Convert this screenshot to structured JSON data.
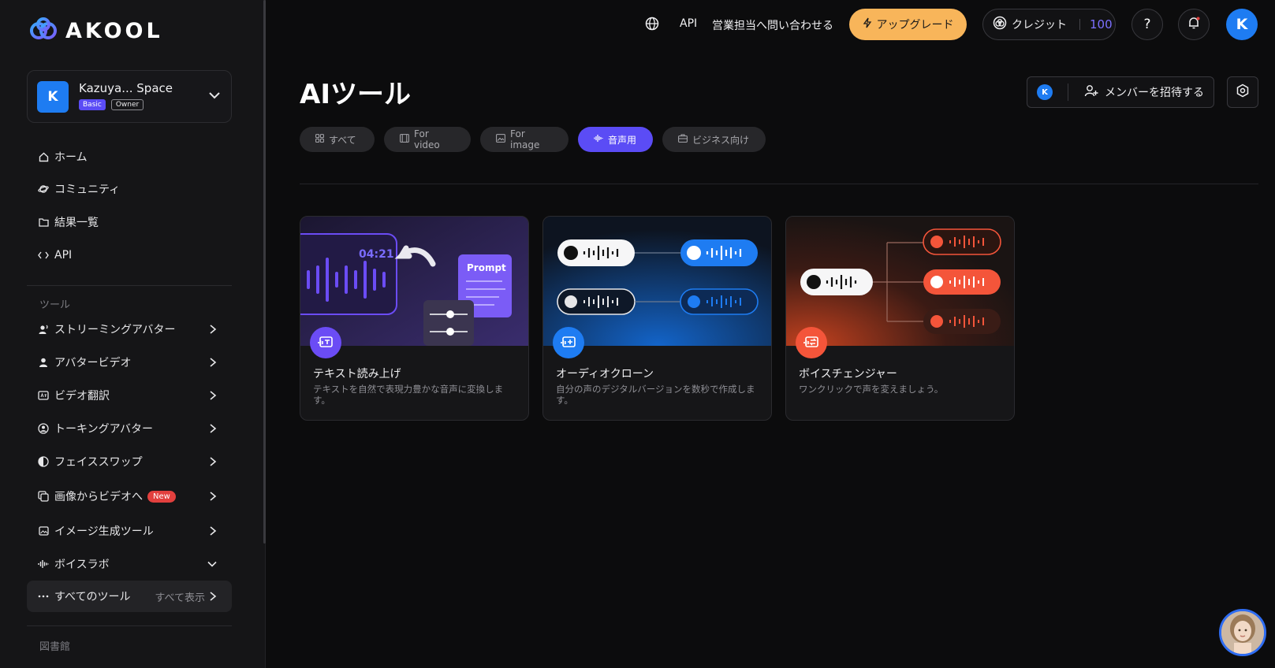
{
  "app": {
    "logo_text": "AKOOL"
  },
  "workspace": {
    "avatar_letter": "K",
    "name": "Kazuya... Space",
    "plan_badge": "Basic",
    "role_badge": "Owner"
  },
  "nav": {
    "home": "ホーム",
    "community": "コミュニティ",
    "results": "結果一覧",
    "api": "API"
  },
  "tools": {
    "section_label": "ツール",
    "items": [
      {
        "label": "ストリーミングアバター"
      },
      {
        "label": "アバタービデオ"
      },
      {
        "label": "ビデオ翻訳"
      },
      {
        "label": "トーキングアバター"
      },
      {
        "label": "フェイススワップ"
      },
      {
        "label": "画像からビデオへ",
        "badge": "New"
      },
      {
        "label": "イメージ生成ツール"
      },
      {
        "label": "ボイスラボ"
      }
    ],
    "all_tools_label": "すべてのツール",
    "see_all_label": "すべて表示"
  },
  "library": {
    "section_label": "図書館"
  },
  "header": {
    "api_label": "API",
    "contact_label": "営業担当へ問い合わせる",
    "upgrade_label": "アップグレード",
    "credits_label": "クレジット",
    "credits_value": "100",
    "help_label": "?",
    "user_avatar_letter": "K"
  },
  "main": {
    "title": "AIツール",
    "invite_avatar_letter": "K",
    "invite_label": "メンバーを招待する",
    "tabs": [
      {
        "label": "すべて",
        "active": false
      },
      {
        "label": "For video",
        "active": false
      },
      {
        "label": "For image",
        "active": false
      },
      {
        "label": "音声用",
        "active": true
      },
      {
        "label": "ビジネス向け",
        "active": false
      }
    ],
    "cards": [
      {
        "title": "テキスト読み上げ",
        "description": "テキストを自然で表現力豊かな音声に変換します。",
        "art_timer": "04:21",
        "art_prompt": "Prompt",
        "accent": "#6b4cf5"
      },
      {
        "title": "オーディオクローン",
        "description": "自分の声のデジタルバージョンを数秒で作成します。",
        "accent": "#1e7cf2"
      },
      {
        "title": "ボイスチェンジャー",
        "description": "ワンクリックで声を変えましょう。",
        "accent": "#f4553a"
      }
    ]
  },
  "colors": {
    "accent_purple": "#5b4cf5",
    "upgrade_orange": "#f8b55a",
    "avatar_blue": "#1e7cf2",
    "new_badge_red": "#e2403e"
  }
}
